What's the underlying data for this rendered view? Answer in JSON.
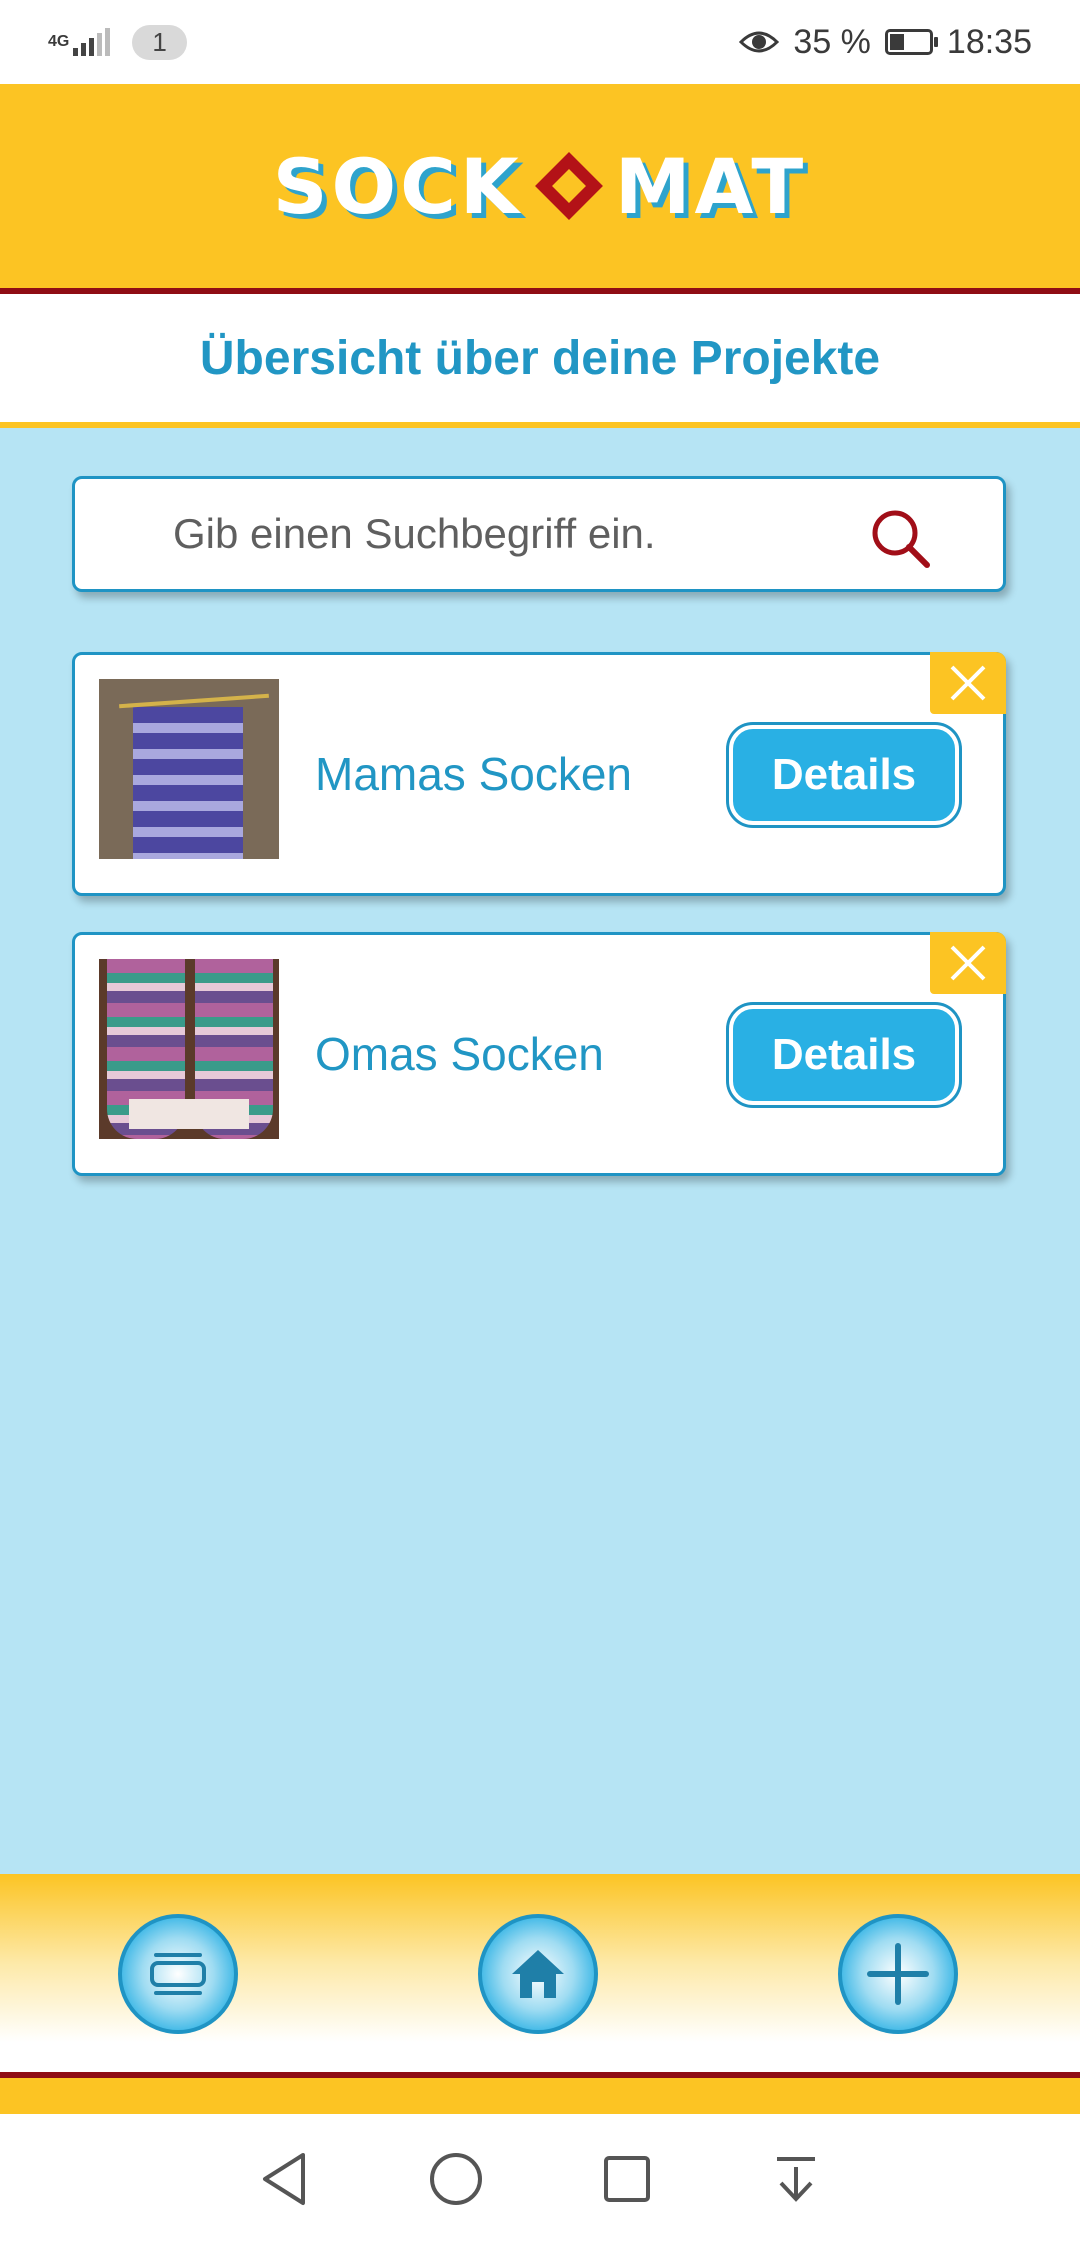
{
  "status_bar": {
    "network": "4G",
    "sim_badge": "1",
    "battery": "35 %",
    "time": "18:35"
  },
  "header": {
    "logo_left": "SOCK",
    "logo_right": "MAT"
  },
  "page_title": "Übersicht über deine Projekte",
  "search": {
    "placeholder": "Gib einen Suchbegriff ein.",
    "value": ""
  },
  "projects": [
    {
      "name": "Mamas Socken",
      "details_label": "Details"
    },
    {
      "name": "Omas Socken",
      "details_label": "Details"
    }
  ],
  "bottom_nav": {
    "items": [
      "list-icon",
      "home-icon",
      "plus-icon"
    ]
  },
  "colors": {
    "accent_yellow": "#fcc423",
    "accent_blue": "#29b0e4",
    "dark_red": "#8f0d14",
    "background": "#b6e4f4",
    "title_blue": "#2196c4"
  }
}
